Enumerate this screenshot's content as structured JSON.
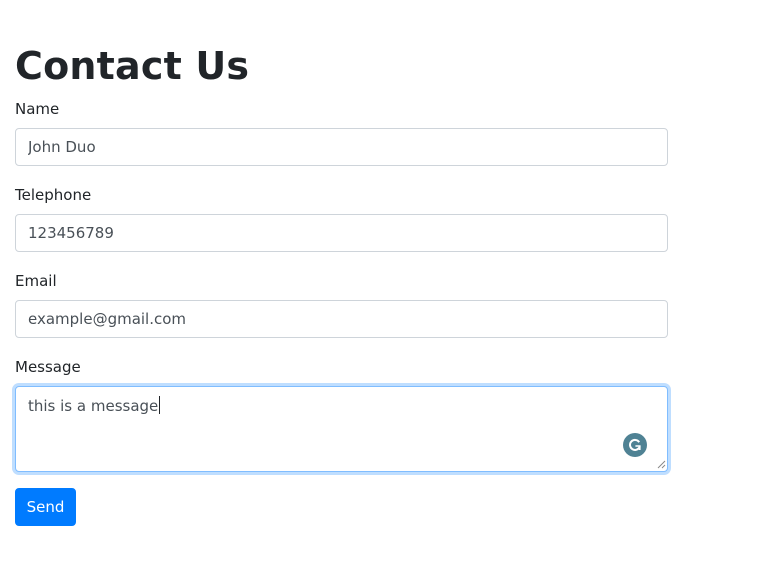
{
  "page": {
    "title": "Contact Us"
  },
  "form": {
    "name": {
      "label": "Name",
      "value": "John Duo"
    },
    "telephone": {
      "label": "Telephone",
      "value": "123456789"
    },
    "email": {
      "label": "Email",
      "value": "example@gmail.com"
    },
    "message": {
      "label": "Message",
      "value": "this is a message"
    },
    "submit_label": "Send"
  },
  "icons": {
    "grammarly": "grammarly-icon",
    "resize": "resize-handle-icon"
  },
  "colors": {
    "primary": "#007bff",
    "focus_border": "#80bdff",
    "grammarly": "#4f8294"
  }
}
